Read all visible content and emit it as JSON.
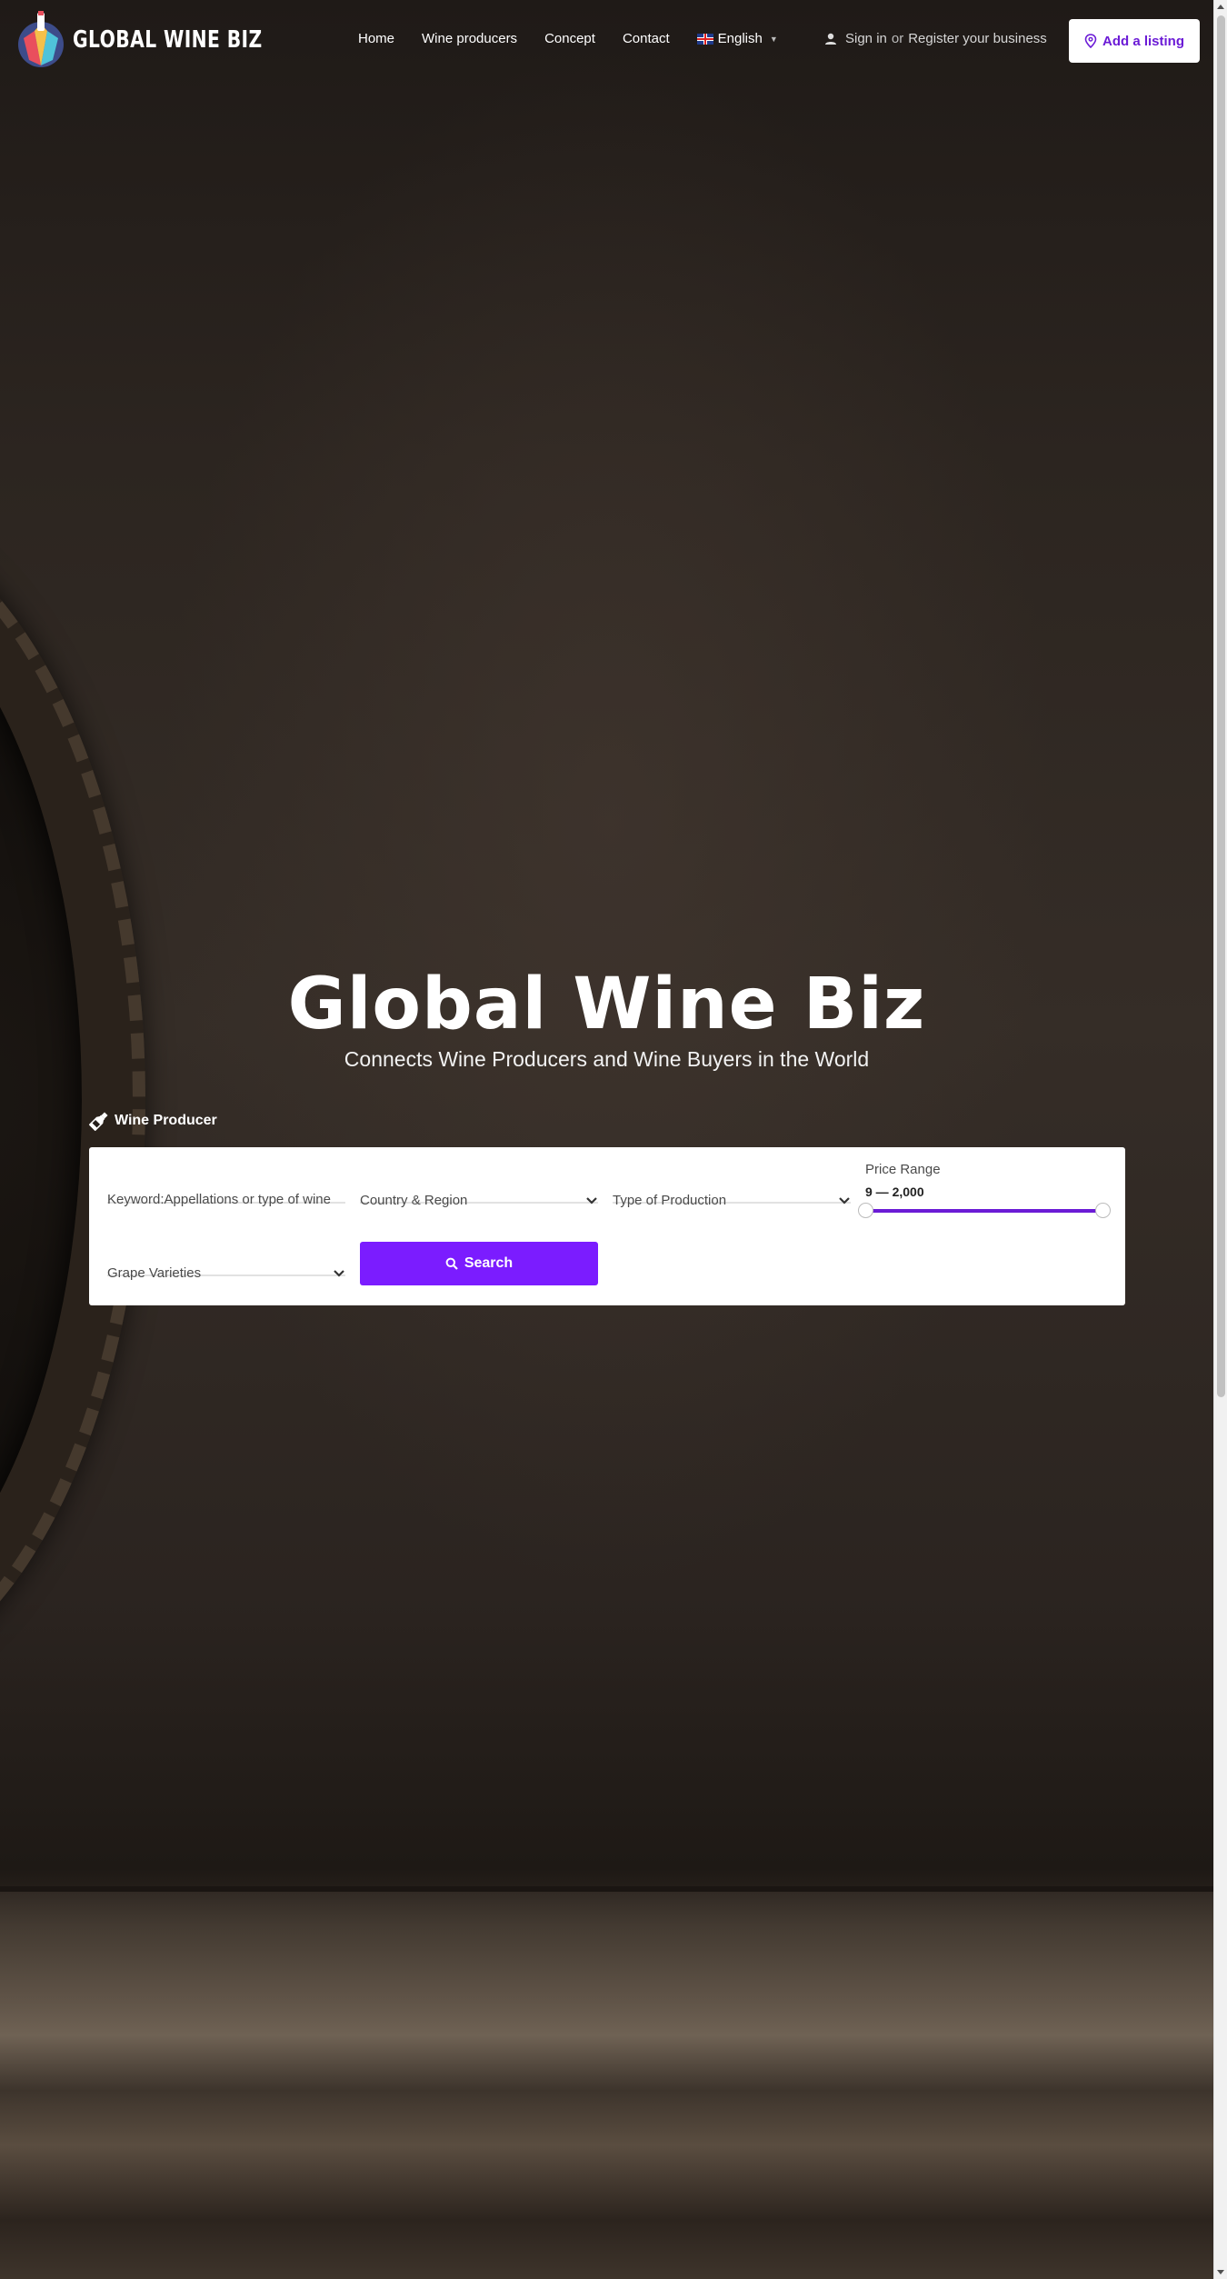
{
  "header": {
    "logo_text": "GLOBAL WINE BIZ",
    "nav": [
      "Home",
      "Wine producers",
      "Concept",
      "Contact"
    ],
    "language": "English",
    "sign_in": "Sign in",
    "or": "or",
    "register": "Register your business",
    "add_listing": "Add a listing"
  },
  "hero": {
    "title": "Global Wine Biz",
    "subtitle": "Connects Wine Producers and Wine Buyers in the World"
  },
  "search": {
    "tab_label": "Wine Producer",
    "keyword_placeholder": "Keyword:Appellations or type of wine",
    "country": "Country & Region",
    "production": "Type of Production",
    "price_label": "Price Range",
    "price_value": "9 — 2,000",
    "price_min": 9,
    "price_max": 2000,
    "grape": "Grape Varieties",
    "search_button": "Search"
  },
  "colors": {
    "accent": "#7b1cff",
    "accent_text": "#6b1bd6"
  },
  "icons": {
    "user": "user-icon",
    "pin": "map-pin-icon",
    "bottle": "wine-bottle-icon",
    "search": "search-icon",
    "chevron": "chevron-down-icon"
  }
}
